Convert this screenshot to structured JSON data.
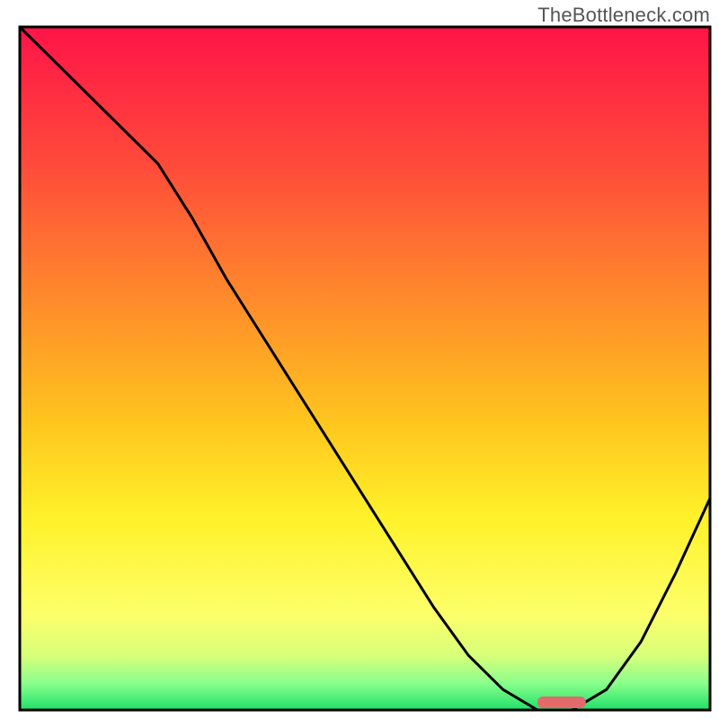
{
  "watermark": "TheBottleneck.com",
  "chart_data": {
    "type": "line",
    "title": "",
    "xlabel": "",
    "ylabel": "",
    "xlim": [
      0,
      100
    ],
    "ylim": [
      0,
      100
    ],
    "x": [
      0,
      5,
      10,
      15,
      20,
      25,
      30,
      35,
      40,
      45,
      50,
      55,
      60,
      65,
      70,
      75,
      80,
      85,
      90,
      95,
      100
    ],
    "values": [
      100,
      95,
      90,
      85,
      80,
      72,
      63,
      55,
      47,
      39,
      31,
      23,
      15,
      8,
      3,
      0,
      0,
      3,
      10,
      20,
      31
    ],
    "marker": {
      "x_start": 75,
      "x_end": 82,
      "y": 0
    },
    "gradient_stops": [
      {
        "pos": 0.0,
        "color": "#ff1448"
      },
      {
        "pos": 0.2,
        "color": "#ff4a3a"
      },
      {
        "pos": 0.4,
        "color": "#ff8b2b"
      },
      {
        "pos": 0.58,
        "color": "#ffc61e"
      },
      {
        "pos": 0.72,
        "color": "#fff22a"
      },
      {
        "pos": 0.86,
        "color": "#fdff6a"
      },
      {
        "pos": 0.92,
        "color": "#d8ff7a"
      },
      {
        "pos": 0.96,
        "color": "#8cff8c"
      },
      {
        "pos": 1.0,
        "color": "#1fe06a"
      }
    ],
    "marker_color": "#e36a6a",
    "line_color": "#000000",
    "border_color": "#000000",
    "grid": false,
    "legend": false
  }
}
